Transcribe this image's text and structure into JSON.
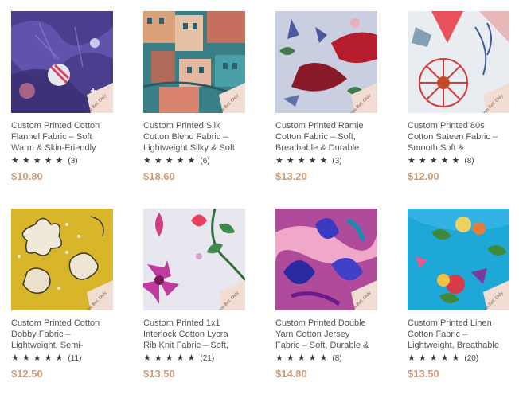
{
  "products": [
    {
      "title_lines": [
        "Custom Printed Cotton",
        "Flannel Fabric – Soft",
        "Warm & Skin-Friendly"
      ],
      "rating_count": "(3)",
      "price": "$10.80",
      "watermark": "Pattern Ref. Only"
    },
    {
      "title_lines": [
        "Custom Printed Silk",
        "Cotton Blend Fabric –",
        "Lightweight Silky & Soft"
      ],
      "rating_count": "(6)",
      "price": "$18.60",
      "watermark": "Pattern Ref. Only"
    },
    {
      "title_lines": [
        "Custom Printed Ramie",
        "Cotton Fabric – Soft,",
        "Breathable & Durable"
      ],
      "rating_count": "(3)",
      "price": "$13.20",
      "watermark": "Pattern Ref. Only"
    },
    {
      "title_lines": [
        "Custom Printed 80s",
        "Cotton Sateen Fabric –",
        "Smooth,Soft &"
      ],
      "rating_count": "(8)",
      "price": "$12.00",
      "watermark": "Pattern Ref. Only"
    },
    {
      "title_lines": [
        "Custom Printed Cotton",
        "Dobby Fabric –",
        "Lightweight, Semi-"
      ],
      "rating_count": "(11)",
      "price": "$12.50",
      "watermark": "Pattern Ref. Only"
    },
    {
      "title_lines": [
        "Custom Printed 1x1",
        "Interlock Cotton Lycra",
        "Rib Knit Fabric – Soft,"
      ],
      "rating_count": "(21)",
      "price": "$13.50",
      "watermark": "Pattern Ref. Only"
    },
    {
      "title_lines": [
        "Custom Printed Double",
        "Yarn Cotton Jersey",
        "Fabric – Soft, Durable &"
      ],
      "rating_count": "(8)",
      "price": "$14.80",
      "watermark": "Pattern Ref. Only"
    },
    {
      "title_lines": [
        "Custom Printed Linen",
        "Cotton Fabric –",
        "Lightweight, Breathable"
      ],
      "rating_count": "(20)",
      "price": "$13.50",
      "watermark": "Pattern Ref. Only"
    }
  ],
  "icons": {
    "star": "star-icon"
  },
  "colors": {
    "price": "#d29a74",
    "title": "#555555",
    "stars": "#3a3a3a"
  }
}
